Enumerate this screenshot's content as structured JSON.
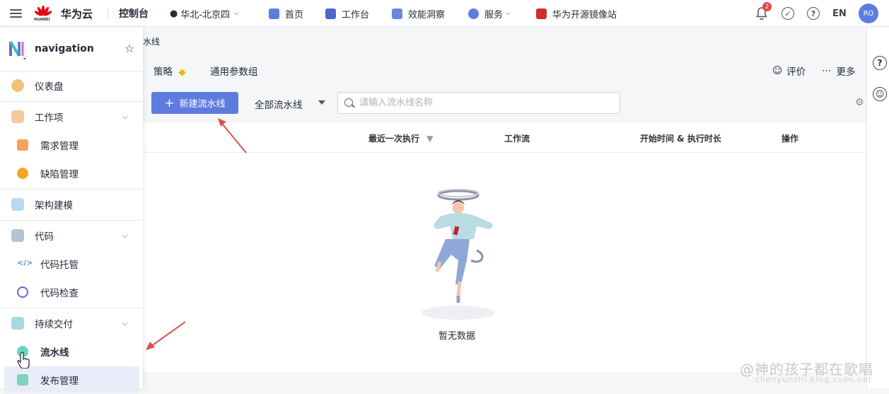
{
  "topbar": {
    "brand": "华为云",
    "brand_sub": "HUAWEI",
    "console": "控制台",
    "region": "华北-北京四",
    "nav": [
      {
        "label": "首页",
        "icon": "home-icon"
      },
      {
        "label": "工作台",
        "icon": "workbench-icon"
      },
      {
        "label": "效能洞察",
        "icon": "insight-icon"
      },
      {
        "label": "服务",
        "icon": "service-icon"
      },
      {
        "label": "华为开源镜像站",
        "icon": "mirror-icon"
      }
    ],
    "notification_count": "2",
    "lang": "EN",
    "avatar": "RO"
  },
  "sidebar": {
    "title": "navigation",
    "items": [
      {
        "label": "仪表盘"
      },
      {
        "label": "工作项"
      },
      {
        "label": "需求管理"
      },
      {
        "label": "缺陷管理"
      },
      {
        "label": "架构建模"
      },
      {
        "label": "代码"
      },
      {
        "label": "代码托管"
      },
      {
        "label": "代码检查"
      },
      {
        "label": "持续交付"
      },
      {
        "label": "流水线"
      },
      {
        "label": "发布管理"
      }
    ]
  },
  "breadcrumb": "水线",
  "tabs": {
    "strategy": "策略",
    "params": "通用参数组",
    "rate": "评价",
    "more": "更多"
  },
  "controls": {
    "new_button": "新建流水线",
    "new_button_icon": "+",
    "filter": "全部流水线",
    "search_placeholder": "请输入流水线名称"
  },
  "table": {
    "columns": [
      "最近一次执行",
      "工作流",
      "开始时间 & 执行时长",
      "操作"
    ],
    "empty_text": "暂无数据"
  },
  "watermark": "@神的孩子都在歌唱",
  "watermark_url": "chenyunzhi.blog.csdn.net",
  "colors": {
    "accent": "#5e7ce0",
    "arrow": "#d9534f",
    "badge": "#e54545"
  }
}
